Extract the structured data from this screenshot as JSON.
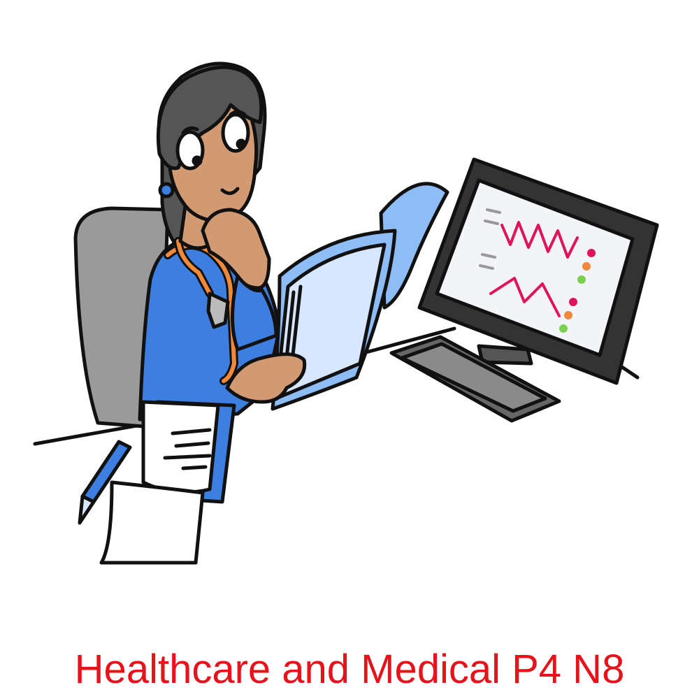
{
  "caption": "Healthcare and Medical P4 N8",
  "colors": {
    "caption": "#e8121a",
    "outline": "#111111",
    "scrubs": "#3d7fe0",
    "skin": "#d29a72",
    "hair": "#555555",
    "chair": "#9a9a9a",
    "chart_folder": "#8ebcf5",
    "monitor_bezel": "#4a4a4a",
    "screen_bg": "#f2f4f8",
    "graph_line": "#e0145a",
    "indicator_red": "#e0145a",
    "indicator_orange": "#f08a3a",
    "indicator_green": "#7ccf50",
    "stethoscope": "#f08a3a",
    "pen": "#3d7fe0"
  },
  "illustration": {
    "subject": "doctor-reviewing-medical-chart",
    "icons": [
      "doctor-figure",
      "medical-chart-folder",
      "computer-monitor",
      "keyboard",
      "stethoscope",
      "pen",
      "notepad"
    ]
  }
}
